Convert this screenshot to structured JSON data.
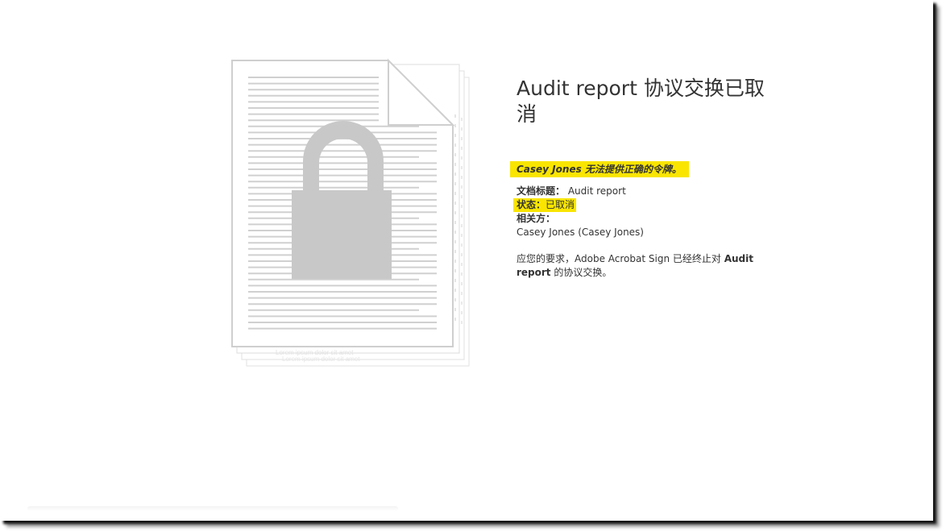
{
  "agreement": {
    "title": "Audit report 协议交换已取消",
    "alert": "Casey Jones 无法提供正确的令牌。",
    "fields": {
      "doc_title_label": "文档标题：",
      "doc_title_value": "Audit report",
      "status_label": "状态：",
      "status_value": "已取消",
      "parties_label": "相关方：",
      "parties_value": "Casey Jones (Casey Jones)"
    },
    "message": {
      "prefix": "应您的要求，Adobe Acrobat Sign 已经终止对 ",
      "doc_name": "Audit report",
      "suffix": " 的协议交换。"
    }
  },
  "illustration": {
    "icon": "locked-document-icon",
    "lock_color": "#c8c8c8",
    "line_color": "#d0d0d0"
  },
  "colors": {
    "highlight": "#f9e500",
    "text": "#333333"
  }
}
